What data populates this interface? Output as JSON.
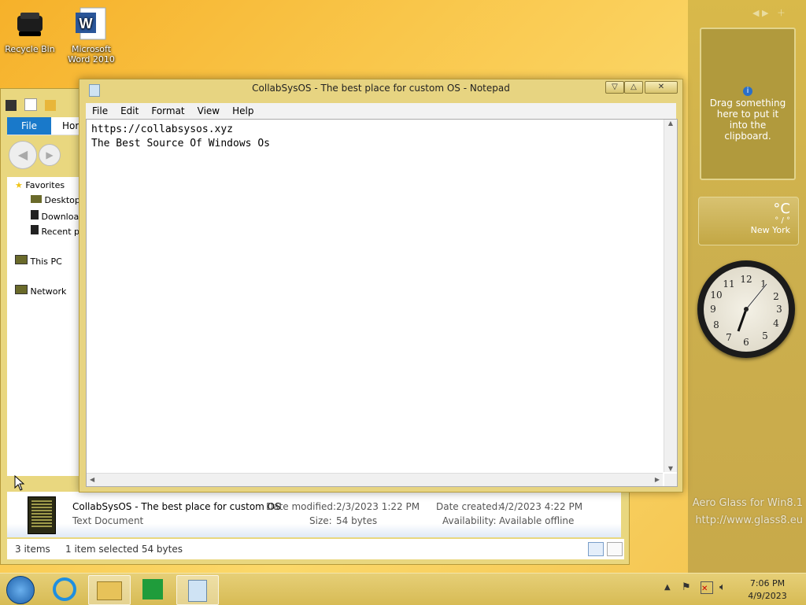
{
  "desktop": {
    "icons": [
      {
        "label": "Recycle Bin",
        "icon": "recycle-bin-icon"
      },
      {
        "label": "Microsoft Word 2010",
        "icon": "word-icon"
      }
    ]
  },
  "explorer": {
    "tabs": {
      "file": "File",
      "home": "Hom"
    },
    "nav": {
      "favorites": "Favorites",
      "desktop": "Desktop",
      "downloads": "Downloa",
      "recent": "Recent p",
      "this_pc": "This PC",
      "network": "Network"
    },
    "details": {
      "name": "CollabSysOS - The best place for custom OS",
      "type": "Text Document",
      "modified_label": "Date modified:",
      "modified_value": "2/3/2023 1:22 PM",
      "size_label": "Size:",
      "size_value": "54 bytes",
      "created_label": "Date created:",
      "created_value": "4/2/2023 4:22 PM",
      "availability_label": "Availability:",
      "availability_value": "Available offline"
    },
    "status": {
      "items": "3 items",
      "selected": "1 item selected  54 bytes"
    }
  },
  "notepad": {
    "title": "CollabSysOS - The best place for custom OS - Notepad",
    "menu": [
      "File",
      "Edit",
      "Format",
      "View",
      "Help"
    ],
    "content_line1": "https://collabsysos.xyz",
    "content_line2": "The Best Source Of Windows Os"
  },
  "gadgets": {
    "clipboard_text": "Drag something here to put it into the clipboard.",
    "weather_unit": "°C",
    "weather_range": "° / °",
    "weather_city": "New York"
  },
  "watermark": {
    "line1": "Aero Glass for Win8.1",
    "line2": "http://www.glass8.eu"
  },
  "taskbar": {
    "time": "7:06 PM",
    "date": "4/9/2023"
  },
  "colors": {
    "accent_blue": "#1979ca",
    "theme_gold": "#d9bb55"
  }
}
